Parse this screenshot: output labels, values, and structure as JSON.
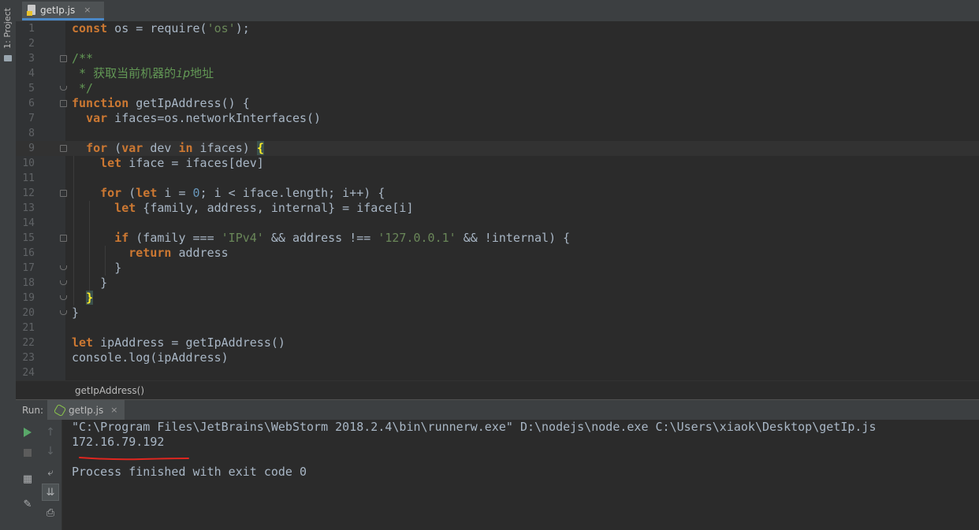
{
  "project_tab": {
    "label": "1: Project"
  },
  "editor_tab": {
    "filename": "getIp.js",
    "close": "×"
  },
  "code_lines": [
    {
      "n": "1"
    },
    {
      "n": "2"
    },
    {
      "n": "3"
    },
    {
      "n": "4"
    },
    {
      "n": "5"
    },
    {
      "n": "6"
    },
    {
      "n": "7"
    },
    {
      "n": "8"
    },
    {
      "n": "9"
    },
    {
      "n": "10"
    },
    {
      "n": "11"
    },
    {
      "n": "12"
    },
    {
      "n": "13"
    },
    {
      "n": "14"
    },
    {
      "n": "15"
    },
    {
      "n": "16"
    },
    {
      "n": "17"
    },
    {
      "n": "18"
    },
    {
      "n": "19"
    },
    {
      "n": "20"
    },
    {
      "n": "21"
    },
    {
      "n": "22"
    },
    {
      "n": "23"
    },
    {
      "n": "24"
    }
  ],
  "code": {
    "l1": {
      "kw": "const",
      "rest": " os = require(",
      "str": "'os'",
      "end": ");"
    },
    "l3": "/**",
    "l4_prefix": " * 获取当前机器的",
    "l4_ip": "ip",
    "l4_suffix": "地址",
    "l5": " */",
    "l6": {
      "kw": "function",
      "rest": " getIpAddress() {"
    },
    "l7": {
      "kw": "var",
      "rest": " ifaces=os.networkInterfaces()"
    },
    "l9": {
      "kw1": "for",
      "p1": " (",
      "kw2": "var",
      "p2": " dev ",
      "kw3": "in",
      "p3": " ifaces) ",
      "brace": "{"
    },
    "l10": {
      "kw": "let",
      "rest": " iface = ifaces[dev]"
    },
    "l12": {
      "kw1": "for",
      "p1": " (",
      "kw2": "let",
      "p2": " i = ",
      "num": "0",
      "p3": "; i < iface.length; i++) {"
    },
    "l13": {
      "kw": "let",
      "rest": " {family, address, internal} = iface[i]"
    },
    "l15": {
      "kw": "if",
      "p1": " (family === ",
      "s1": "'IPv4'",
      "p2": " && address !== ",
      "s2": "'127.0.0.1'",
      "p3": " && !internal) {"
    },
    "l16": {
      "kw": "return",
      "rest": " address"
    },
    "l17": "}",
    "l18": "}",
    "l19": "}",
    "l20": "}",
    "l22": {
      "kw": "let",
      "rest": " ipAddress = getIpAddress()"
    },
    "l23": "console.log(ipAddress)"
  },
  "breadcrumb": "getIpAddress()",
  "run_panel": {
    "label": "Run:",
    "tab": "getIp.js",
    "close": "×",
    "output": [
      "\"C:\\Program Files\\JetBrains\\WebStorm 2018.2.4\\bin\\runnerw.exe\" D:\\nodejs\\node.exe C:\\Users\\xiaok\\Desktop\\getIp.js",
      "172.16.79.192",
      "",
      "Process finished with exit code 0"
    ]
  },
  "colors": {
    "keyword": "#cc7832",
    "string": "#6a8759",
    "number": "#6897bb",
    "comment": "#629755",
    "annotation": "#e0261f"
  }
}
